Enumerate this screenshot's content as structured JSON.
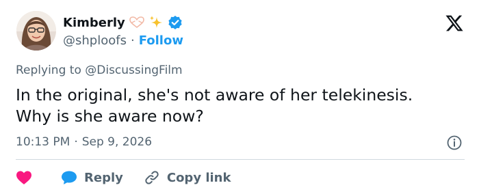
{
  "author": {
    "display_name": "Kimberly",
    "handle": "@shploofs",
    "separator": "·",
    "follow_label": "Follow",
    "name_decorations": [
      "heart-hands-icon",
      "sparkles-icon",
      "verified-badge-icon"
    ]
  },
  "reply_context": {
    "prefix": "Replying to",
    "mention": "@DiscussingFilm"
  },
  "tweet": {
    "text_line1": "In the original, she's not aware of her telekinesis.",
    "text_line2": "Why is she aware now?",
    "time": "10:13 PM",
    "separator": "·",
    "date": "Sep 9, 2026"
  },
  "actions": {
    "like_label": "",
    "reply_label": "Reply",
    "copy_link_label": "Copy link"
  },
  "colors": {
    "accent": "#1d9bf0",
    "like": "#f91880",
    "text": "#0f1419",
    "muted": "#536471",
    "divider": "#cfd9de"
  }
}
